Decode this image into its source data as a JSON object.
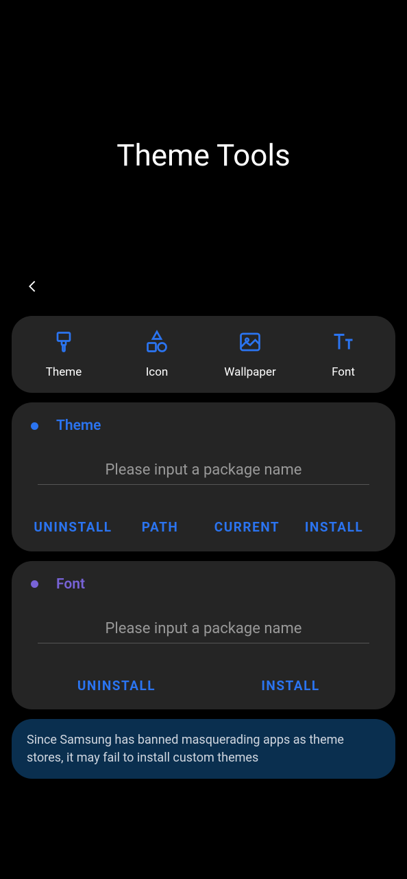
{
  "header": {
    "title": "Theme Tools"
  },
  "tabs": {
    "theme": "Theme",
    "icon": "Icon",
    "wallpaper": "Wallpaper",
    "font": "Font"
  },
  "themeSection": {
    "title": "Theme",
    "placeholder": "Please input a package name",
    "actions": {
      "uninstall": "UNINSTALL",
      "path": "PATH",
      "current": "CURRENT",
      "install": "INSTALL"
    }
  },
  "fontSection": {
    "title": "Font",
    "placeholder": "Please input a package name",
    "actions": {
      "uninstall": "UNINSTALL",
      "install": "INSTALL"
    }
  },
  "notice": {
    "text": "Since Samsung has banned masquerading apps as theme stores, it may fail to install custom themes"
  },
  "colors": {
    "accent": "#2b74f0",
    "purple": "#7863d7",
    "cardBg": "#252525",
    "noticeBg": "#0a2f4f"
  }
}
